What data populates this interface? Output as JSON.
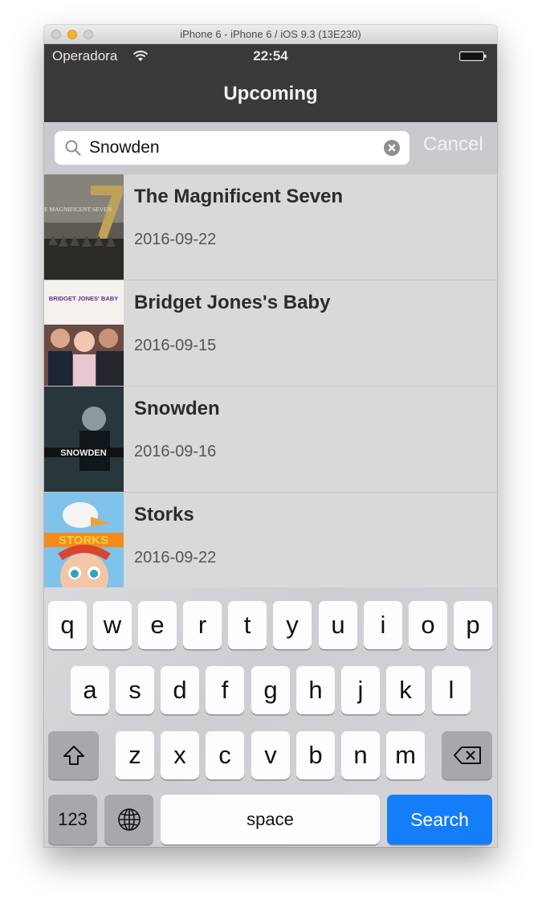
{
  "window": {
    "title": "iPhone 6 - iPhone 6 / iOS 9.3 (13E230)"
  },
  "status_bar": {
    "carrier": "Operadora",
    "time": "22:54"
  },
  "nav": {
    "title": "Upcoming"
  },
  "search": {
    "value": "Snowden",
    "cancel_label": "Cancel"
  },
  "movies": [
    {
      "title": "The Magnificent Seven",
      "date": "2016-09-22",
      "poster_text": "THE MAGNIFICENT SEVEN"
    },
    {
      "title": "Bridget Jones's Baby",
      "date": "2016-09-15",
      "poster_text": "BRIDGET JONES' BABY"
    },
    {
      "title": "Snowden",
      "date": "2016-09-16",
      "poster_text": "SNOWDEN"
    },
    {
      "title": "Storks",
      "date": "2016-09-22",
      "poster_text": "STORKS"
    }
  ],
  "keyboard": {
    "row1": [
      "q",
      "w",
      "e",
      "r",
      "t",
      "y",
      "u",
      "i",
      "o",
      "p"
    ],
    "row2": [
      "a",
      "s",
      "d",
      "f",
      "g",
      "h",
      "j",
      "k",
      "l"
    ],
    "row3": [
      "z",
      "x",
      "c",
      "v",
      "b",
      "n",
      "m"
    ],
    "numbers_label": "123",
    "space_label": "space",
    "search_label": "Search"
  },
  "colors": {
    "nav_bg": "#3b3839",
    "search_key": "#137dfa",
    "row_bg": "#d9d9d9"
  }
}
